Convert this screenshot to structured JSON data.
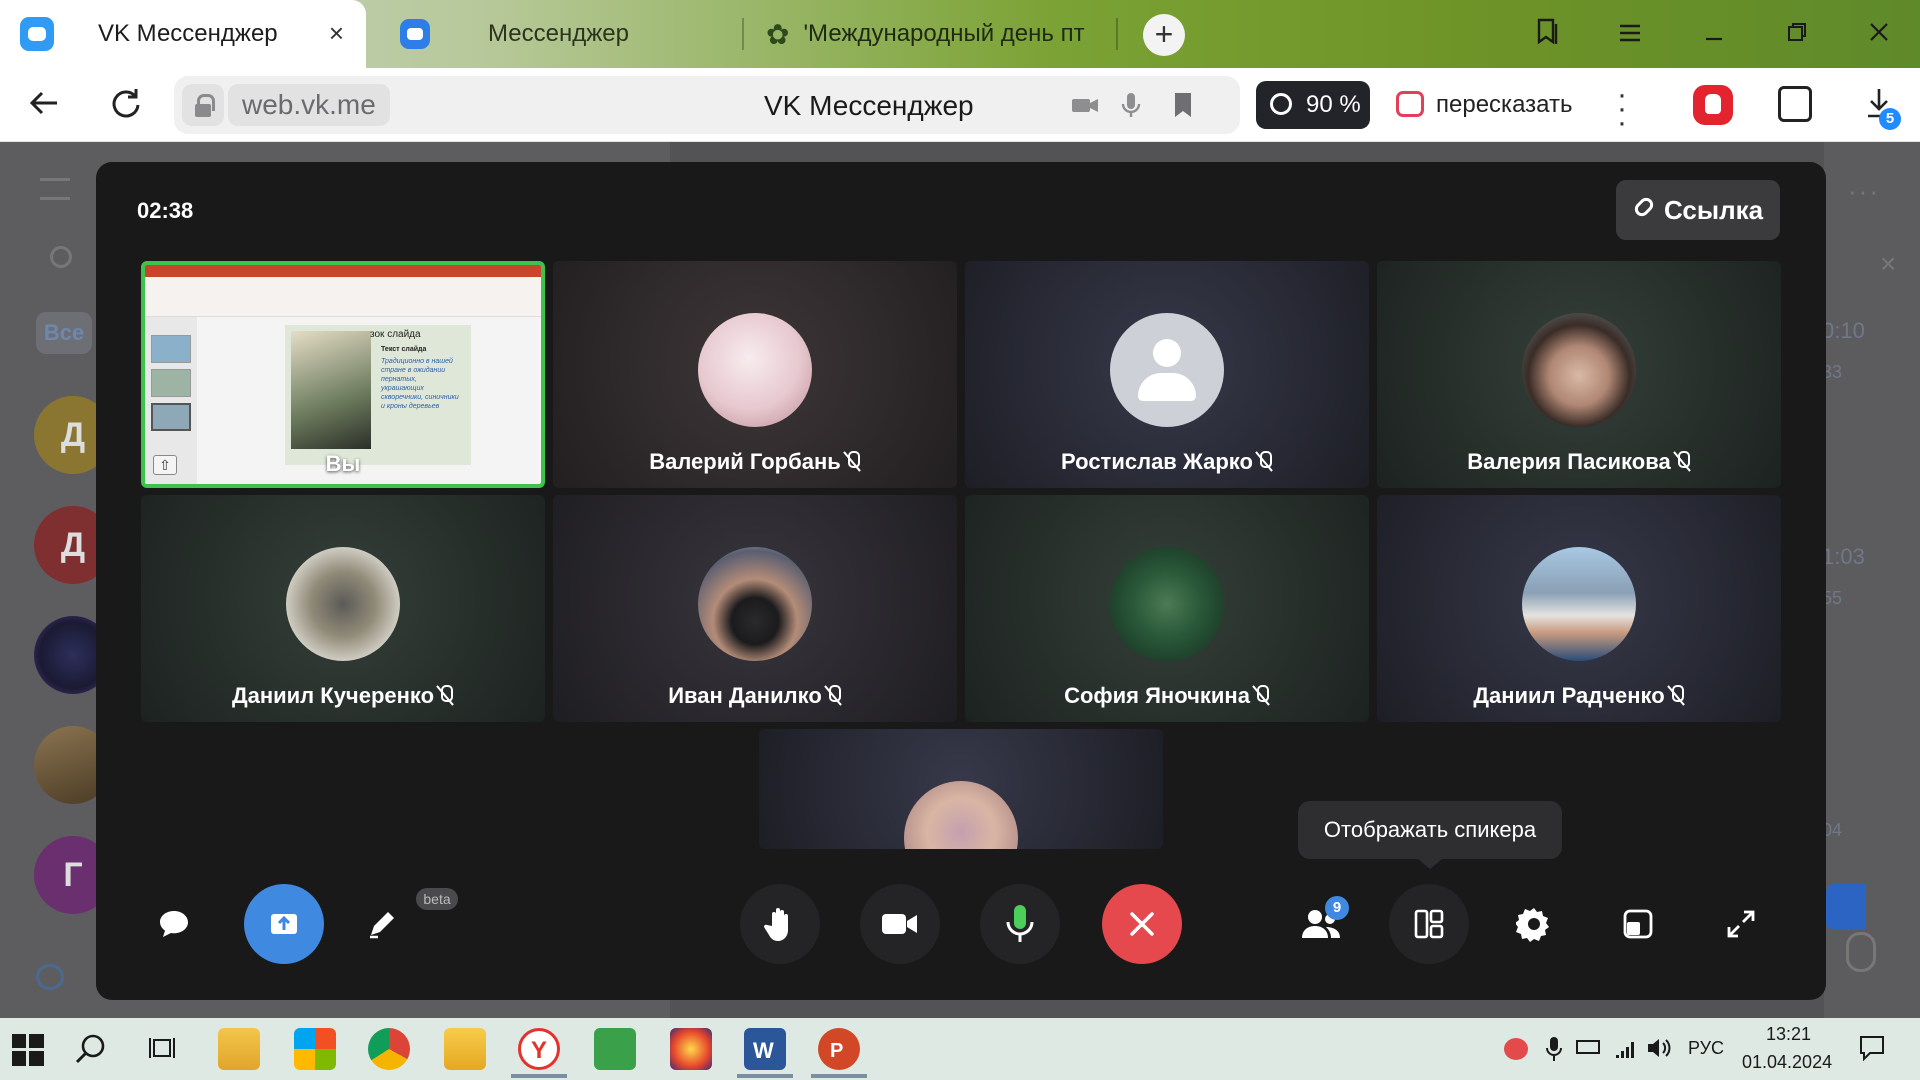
{
  "browser": {
    "tabs": [
      {
        "title": "VK Мессенджер",
        "active": true
      },
      {
        "title": "Мессенджер",
        "active": false
      },
      {
        "title": "'Международный день пт",
        "active": false
      }
    ],
    "address": {
      "domain": "web.vk.me",
      "page_title": "VK Мессенджер"
    },
    "zoom": "90 %",
    "retell_label": "пересказать",
    "downloads_badge": "5"
  },
  "background": {
    "filter_label": "Все",
    "avatars": [
      "Д",
      "Д",
      "Г"
    ],
    "times": [
      "0:10",
      "33",
      "1:03",
      "55",
      "04"
    ]
  },
  "call": {
    "timer": "02:38",
    "link_label": "Ссылка",
    "self": {
      "name": "Вы",
      "slide_heading": "зок слайда",
      "slide_subheading": "Текст слайда",
      "slide_text": "Традиционно в нашей стране в ожидании пернатых, украшающих скворечники, синичники и кроны деревьев"
    },
    "participants": [
      {
        "name": "Валерий Горбань",
        "muted": true
      },
      {
        "name": "Ростислав Жарко",
        "muted": true
      },
      {
        "name": "Валерия Пасикова",
        "muted": true
      },
      {
        "name": "Даниил Кучеренко",
        "muted": true
      },
      {
        "name": "Иван Данилко",
        "muted": true
      },
      {
        "name": "София Яночкина",
        "muted": true
      },
      {
        "name": "Даниил Радченко",
        "muted": true
      }
    ],
    "tooltip": "Отображать спикера",
    "beta_label": "beta",
    "participants_count": "9"
  },
  "taskbar": {
    "language": "РУС",
    "time": "13:21",
    "date": "01.04.2024"
  },
  "colors": {
    "accent_blue": "#3f8ae0",
    "end_call_red": "#e5484d",
    "speaker_green": "#3ec24c"
  }
}
